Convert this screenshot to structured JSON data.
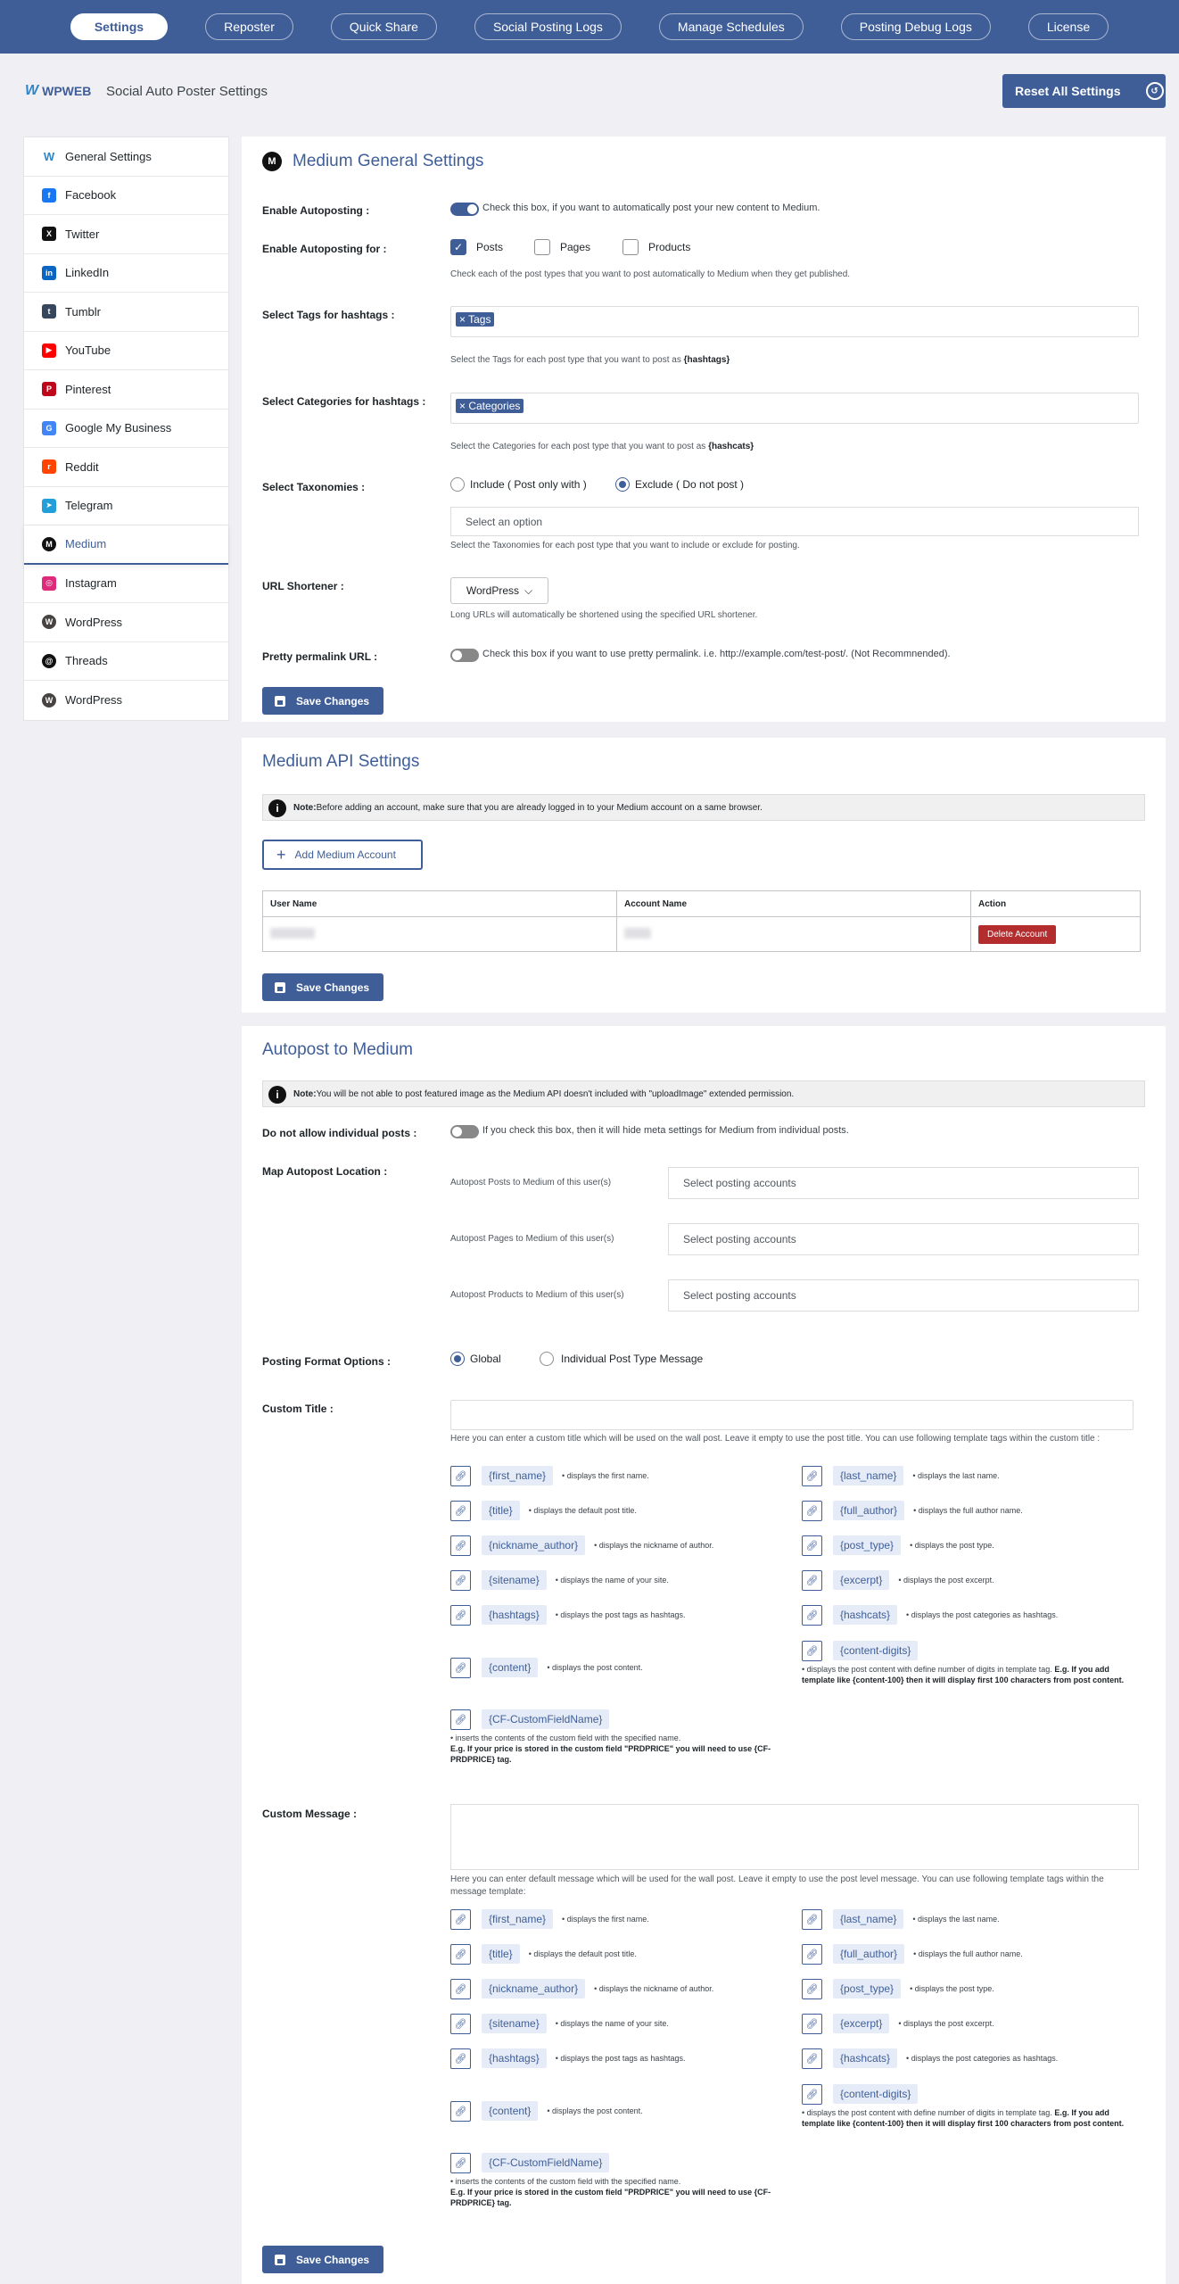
{
  "topnav": {
    "tabs": [
      "Settings",
      "Reposter",
      "Quick Share",
      "Social Posting Logs",
      "Manage Schedules",
      "Posting Debug Logs",
      "License"
    ]
  },
  "header": {
    "brand": "WPWEB",
    "title": "Social Auto Poster Settings",
    "reset_label": "Reset All Settings"
  },
  "sidebar": {
    "items": [
      {
        "label": "General Settings",
        "icon": "wpweb-icon",
        "color": "#2e86c8"
      },
      {
        "label": "Facebook",
        "icon": "facebook-icon",
        "color": "#1877f2"
      },
      {
        "label": "Twitter",
        "icon": "x-icon",
        "color": "#111111"
      },
      {
        "label": "LinkedIn",
        "icon": "linkedin-icon",
        "color": "#0a66c2"
      },
      {
        "label": "Tumblr",
        "icon": "tumblr-icon",
        "color": "#36465d"
      },
      {
        "label": "YouTube",
        "icon": "youtube-icon",
        "color": "#ff0000"
      },
      {
        "label": "Pinterest",
        "icon": "pinterest-icon",
        "color": "#bd081c"
      },
      {
        "label": "Google My Business",
        "icon": "google-business-icon",
        "color": "#4285f4"
      },
      {
        "label": "Reddit",
        "icon": "reddit-icon",
        "color": "#ff4500"
      },
      {
        "label": "Telegram",
        "icon": "telegram-icon",
        "color": "#229ed9"
      },
      {
        "label": "Medium",
        "icon": "medium-icon",
        "color": "#111111"
      },
      {
        "label": "Instagram",
        "icon": "instagram-icon",
        "color": "#dd2a7b"
      },
      {
        "label": "WordPress",
        "icon": "wordpress-icon",
        "color": "#464342"
      },
      {
        "label": "Threads",
        "icon": "threads-icon",
        "color": "#111111"
      },
      {
        "label": "WordPress",
        "icon": "wordpress-icon",
        "color": "#464342"
      }
    ]
  },
  "general": {
    "title": "Medium General Settings",
    "enable_label": "Enable Autoposting :",
    "enable_help": "Check this box, if you want to automatically post your new content to Medium.",
    "enable_for_label": "Enable Autoposting for :",
    "post_types": [
      "Posts",
      "Pages",
      "Products"
    ],
    "post_types_help": "Check each of the post types that you want to post automatically to Medium when they get published.",
    "tags_label": "Select Tags for hashtags :",
    "tags_chip": "Tags",
    "tags_help_pre": "Select the Tags for each post type that you want to post as ",
    "tags_help_bold": "{hashtags}",
    "cats_label": "Select Categories for hashtags :",
    "cats_chip": "Categories",
    "cats_help_pre": "Select the Categories for each post type that you want to post as ",
    "cats_help_bold": "{hashcats}",
    "tax_label": "Select Taxonomies :",
    "tax_include": "Include ( Post only with )",
    "tax_exclude": "Exclude ( Do not post )",
    "tax_placeholder": "Select an option",
    "tax_help": "Select the Taxonomies for each post type that you want to include or exclude for posting.",
    "shortener_label": "URL Shortener :",
    "shortener_value": "WordPress",
    "shortener_help": "Long URLs will automatically be shortened using the specified URL shortener.",
    "pretty_label": "Pretty permalink URL :",
    "pretty_help": "Check this box if you want to use pretty permalink. i.e. http://example.com/test-post/. (Not Recommnended).",
    "save": "Save Changes"
  },
  "api": {
    "title": "Medium API Settings",
    "note_bold": "Note:",
    "note_text": " Before adding an account, make sure that you are already logged in to your Medium account on a same browser.",
    "add_label": "Add Medium Account",
    "columns": [
      "User Name",
      "Account Name",
      "Action"
    ],
    "delete_label": "Delete Account",
    "save": "Save Changes"
  },
  "autopost": {
    "title": "Autopost to Medium",
    "note_bold": "Note:",
    "note_text": " You will be not able to post featured image as the Medium API doesn't included with \"uploadImage\" extended permission.",
    "disallow_label": "Do not allow individual posts :",
    "disallow_help": "If you check this box, then it will hide meta settings for Medium from individual posts.",
    "map_label": "Map Autopost Location :",
    "map_rows": [
      {
        "label": "Autopost Posts to Medium of this user(s)",
        "placeholder": "Select posting accounts"
      },
      {
        "label": "Autopost Pages to Medium of this user(s)",
        "placeholder": "Select posting accounts"
      },
      {
        "label": "Autopost Products to Medium of this user(s)",
        "placeholder": "Select posting accounts"
      }
    ],
    "format_label": "Posting Format Options :",
    "format_global": "Global",
    "format_individual": "Individual Post Type Message",
    "title_label": "Custom Title :",
    "title_help": "Here you can enter a custom title which will be used on the wall post. Leave it empty to use the post title. You can use following template tags within the custom title :",
    "message_label": "Custom Message :",
    "message_help": "Here you can enter default message which will be used for the wall post. Leave it empty to use the post level message. You can use following template tags within the message template:",
    "tags": [
      {
        "name": "{first_name}",
        "desc": "displays the first name."
      },
      {
        "name": "{last_name}",
        "desc": "displays the last name."
      },
      {
        "name": "{title}",
        "desc": "displays the default post title."
      },
      {
        "name": "{full_author}",
        "desc": "displays the full author name."
      },
      {
        "name": "{nickname_author}",
        "desc": "displays the nickname of author."
      },
      {
        "name": "{post_type}",
        "desc": "displays the post type."
      },
      {
        "name": "{sitename}",
        "desc": "displays the name of your site."
      },
      {
        "name": "{excerpt}",
        "desc": "displays the post excerpt."
      },
      {
        "name": "{hashtags}",
        "desc": "displays the post tags as hashtags."
      },
      {
        "name": "{hashcats}",
        "desc": "displays the post categories as hashtags."
      },
      {
        "name": "{content}",
        "desc": "displays the post content."
      }
    ],
    "digits_tag": "{content-digits}",
    "digits_desc": "displays the post content with define number of digits in template tag.",
    "digits_bold": "E.g. If you add template like {content-100} then it will display first 100 characters from post content.",
    "cf_tag": "{CF-CustomFieldName}",
    "cf_desc": "inserts the contents of the custom field with the specified name.",
    "cf_bold": "E.g. If your price is stored in the custom field \"PRDPRICE\" you will need to use {CF-PRDPRICE} tag.",
    "save": "Save Changes"
  }
}
